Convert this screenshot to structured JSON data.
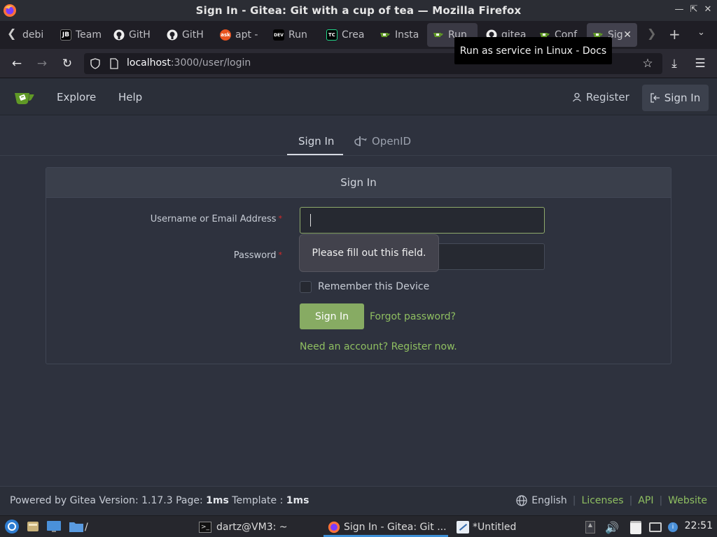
{
  "window": {
    "title": "Sign In - Gitea: Git with a cup of tea — Mozilla Firefox"
  },
  "tabs": [
    {
      "label": "debi",
      "icon": "debian-icon"
    },
    {
      "label": "Team",
      "icon": "jetbrains-icon",
      "icon_text": "JB"
    },
    {
      "label": "GitH",
      "icon": "github-icon"
    },
    {
      "label": "GitH",
      "icon": "github-icon"
    },
    {
      "label": "apt -",
      "icon": "askubuntu-icon",
      "icon_text": "ask"
    },
    {
      "label": "Run",
      "icon": "devto-icon",
      "icon_text": "DEV"
    },
    {
      "label": "Crea",
      "icon": "teamcity-icon",
      "icon_text": "TC"
    },
    {
      "label": "Insta",
      "icon": "gitea-icon"
    },
    {
      "label": "Run",
      "icon": "gitea-icon"
    },
    {
      "label": "gitea",
      "icon": "github-icon"
    },
    {
      "label": "Conf",
      "icon": "gitea-icon"
    },
    {
      "label": "Sig",
      "icon": "gitea-icon"
    }
  ],
  "tab_tooltip": "Run as service in Linux - Docs",
  "browser": {
    "url_host": "localhost",
    "url_rest": ":3000/user/login"
  },
  "gitea": {
    "nav_explore": "Explore",
    "nav_help": "Help",
    "register": "Register",
    "sign_in": "Sign In",
    "tab_signin": "Sign In",
    "tab_openid": "OpenID",
    "card_title": "Sign In",
    "username_label": "Username or Email Address",
    "password_label": "Password",
    "required_mark": "*",
    "username_value": "",
    "password_value": "",
    "remember_label": "Remember this Device",
    "signin_button": "Sign In",
    "forgot_link": "Forgot password?",
    "need_account": "Need an account? Register now.",
    "validation_tip": "Please fill out this field."
  },
  "footer": {
    "powered_prefix": "Powered by Gitea Version: 1.17.3 Page: ",
    "page_time": "1ms",
    "template_prefix": " Template : ",
    "template_time": "1ms",
    "language": "English",
    "licenses": "Licenses",
    "api": "API",
    "website": "Website"
  },
  "taskbar": {
    "folder_path": "/",
    "terminal": "dartz@VM3: ~",
    "firefox": "Sign In - Gitea: Git ...",
    "editor": "*Untitled",
    "clock": "22:51"
  },
  "colors": {
    "accent_green": "#87ab63",
    "link_green": "#8fbf61",
    "required_red": "#db2828",
    "page_bg": "#2e323e"
  }
}
